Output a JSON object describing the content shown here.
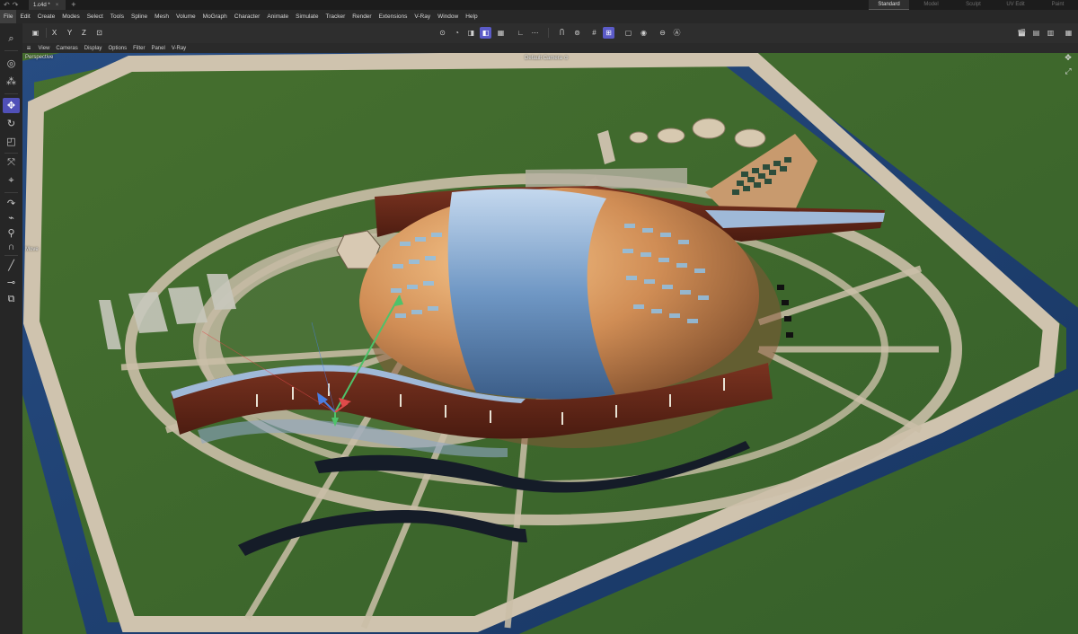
{
  "titlebar": {
    "back_icon": "undo-arrow-icon",
    "forward_icon": "redo-arrow-icon",
    "document_tab": "1.c4d *",
    "close_glyph": "×",
    "new_tab_glyph": "+",
    "layouts": [
      {
        "label": "Standard",
        "active": true
      },
      {
        "label": "Model",
        "active": false
      },
      {
        "label": "Sculpt",
        "active": false
      },
      {
        "label": "UV Edit",
        "active": false
      },
      {
        "label": "Paint",
        "active": false
      }
    ]
  },
  "menu": [
    "File",
    "Edit",
    "Create",
    "Modes",
    "Select",
    "Tools",
    "Spline",
    "Mesh",
    "Volume",
    "MoGraph",
    "Character",
    "Animate",
    "Simulate",
    "Tracker",
    "Render",
    "Extensions",
    "V-Ray",
    "Window",
    "Help"
  ],
  "toolbar": {
    "axis_x": "X",
    "axis_y": "Y",
    "axis_z": "Z"
  },
  "viewport_menu": [
    "View",
    "Cameras",
    "Display",
    "Options",
    "Filter",
    "Panel",
    "V-Ray"
  ],
  "viewport": {
    "view_name": "Perspective",
    "camera_label": "Default Camera",
    "camera_icon": "⊙",
    "tool_hint": "Move"
  },
  "colors": {
    "accent": "#5b5bc8",
    "grass": "#3d6a2b",
    "water": "#1f3f6e",
    "paving": "#c9bfae",
    "dome_gold": "#d4915a",
    "dome_glass": "#8fb4d6",
    "wall_wood": "#6b2a18"
  }
}
